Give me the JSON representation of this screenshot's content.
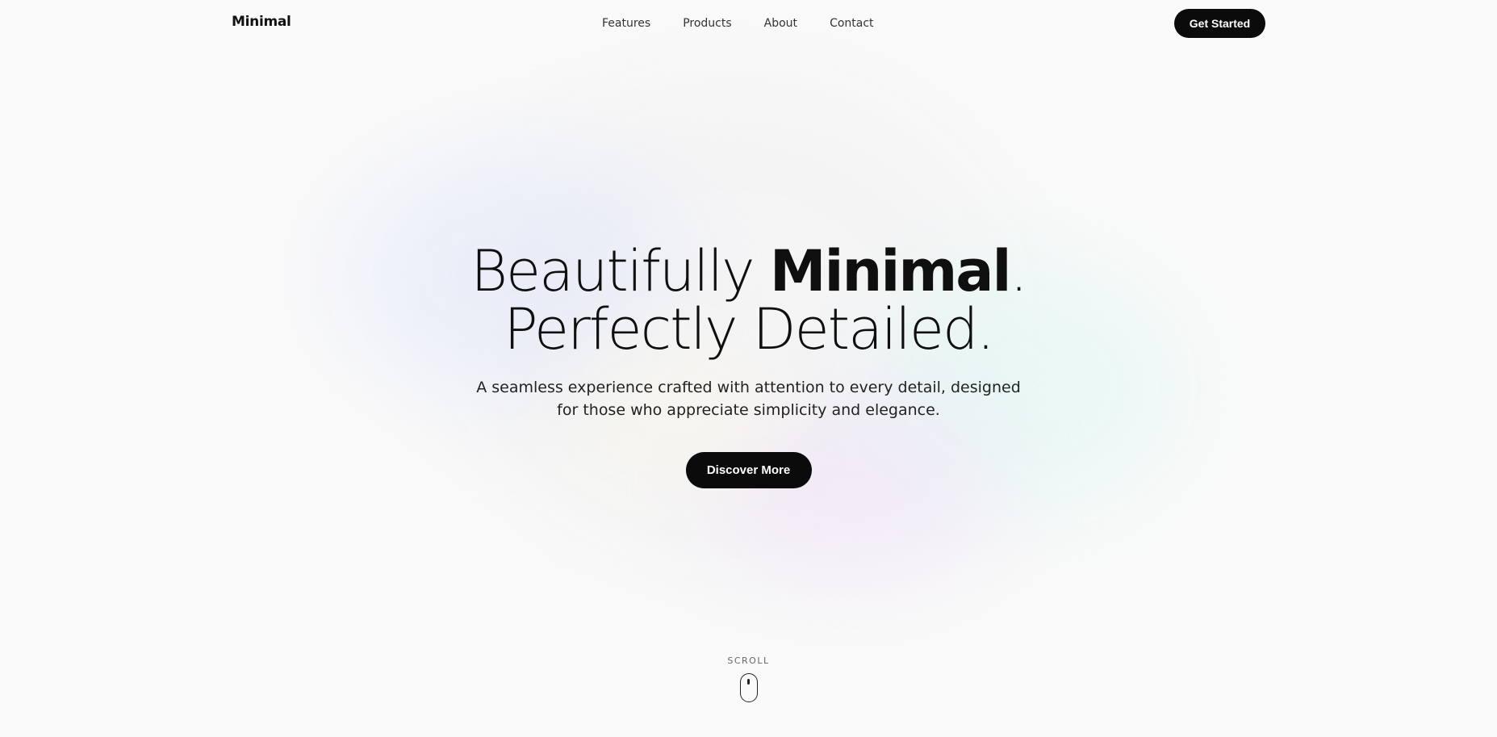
{
  "nav": {
    "logo": "Minimal",
    "links": [
      "Features",
      "Products",
      "About",
      "Contact"
    ],
    "cta_label": "Get Started"
  },
  "hero": {
    "headline_line1_light": "Beautifully ",
    "headline_line1_bold": "Minimal",
    "headline_line1_end": ".",
    "headline_line2": "Perfectly Detailed.",
    "subtitle": "A seamless experience crafted with attention to every detail, designed for those who appreciate simplicity and elegance.",
    "cta_label": "Discover More"
  },
  "scroll": {
    "label": "SCROLL",
    "icon": "mouse-icon"
  },
  "colors": {
    "background": "#fafafa",
    "button": "#0b0b0b",
    "text": "#111111"
  }
}
